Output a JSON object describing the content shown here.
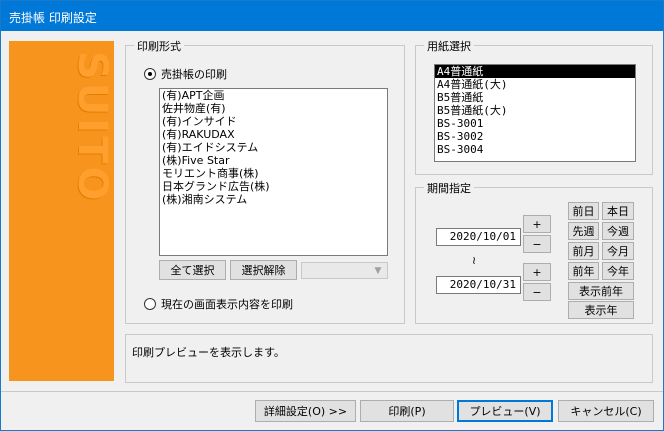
{
  "window": {
    "title": "売掛帳 印刷設定"
  },
  "brand": {
    "text": "SUITO",
    "color": "#f7941d"
  },
  "print_format": {
    "label": "印刷形式",
    "radio_ledger": "売掛帳の印刷",
    "customers": [
      "(有)APT企画",
      "佐井物産(有)",
      "(有)インサイド",
      "(有)RAKUDAX",
      "(有)エイドシステム",
      "(株)Five Star",
      "モリエント商事(株)",
      "日本グランド広告(株)",
      "(株)湘南システム"
    ],
    "select_all": "全て選択",
    "deselect": "選択解除",
    "combo_value": "",
    "radio_screen": "現在の画面表示内容を印刷"
  },
  "paper": {
    "label": "用紙選択",
    "items": [
      "A4普通紙",
      "A4普通紙(大)",
      "B5普通紙",
      "B5普通紙(大)",
      "BS-3001",
      "BS-3002",
      "BS-3004"
    ],
    "selected_index": 0
  },
  "period": {
    "label": "期間指定",
    "start": "2020/10/01",
    "end": "2020/10/31",
    "tilde": "≀",
    "plus": "+",
    "minus": "−",
    "prev_day": "前日",
    "today": "本日",
    "prev_week": "先週",
    "this_week": "今週",
    "prev_month": "前月",
    "this_month": "今月",
    "prev_year": "前年",
    "this_year": "今年",
    "show_prev_year": "表示前年",
    "show_year": "表示年"
  },
  "message": "印刷プレビューを表示します。",
  "footer": {
    "detail": "詳細設定(O) >>",
    "print": "印刷(P)",
    "preview": "プレビュー(V)",
    "cancel": "キャンセル(C)"
  }
}
